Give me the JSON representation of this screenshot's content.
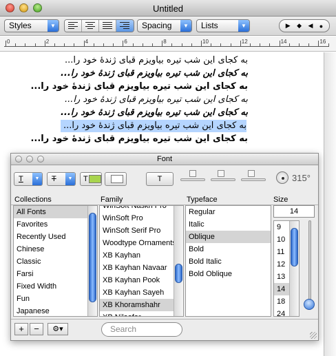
{
  "window": {
    "title": "Untitled"
  },
  "toolbar": {
    "styles_label": "Styles",
    "spacing_label": "Spacing",
    "lists_label": "Lists",
    "align_buttons": [
      "align-left",
      "align-center",
      "justify",
      "align-right"
    ],
    "active_alignment": "align-right",
    "media_icons": [
      "play-arrow",
      "diamond",
      "stop",
      "record"
    ]
  },
  "ruler": {
    "numbers": [
      "0",
      "2",
      "4",
      "6",
      "8",
      "10",
      "12",
      "14",
      "16"
    ]
  },
  "document": {
    "lines": [
      {
        "text": "به کجای این شب تیره بیاویزم قبای ژندهٔ خود را...",
        "style": "normal"
      },
      {
        "text": "به کجای این شب تیره بیاویزم قبای ژندهٔ خود را...",
        "style": "bold-italic"
      },
      {
        "text": "به کجای این شب تیره بیاویزم قبای ژندهٔ خود را...",
        "style": "bold"
      },
      {
        "text": "به کجای این شب تیره بیاویزم قبای ژندهٔ خود را...",
        "style": "italic"
      },
      {
        "text": "به کجای این شب تیره بیاویزم قبای ژندهٔ خود را...",
        "style": "bold-italic"
      },
      {
        "text": "به کجای این شب تیره بیاویزم قبای ژندهٔ خود را...",
        "style": "selected"
      },
      {
        "text": "به کجای این شب تیره بیاویزم قبای ژندهٔ خود را...",
        "style": "bold"
      }
    ]
  },
  "font_panel": {
    "title": "Font",
    "rotation": "315°",
    "text_color": "#a8d44e",
    "headers": {
      "collections": "Collections",
      "family": "Family",
      "typeface": "Typeface",
      "size": "Size"
    },
    "collections": [
      "All Fonts",
      "Favorites",
      "Recently Used",
      "Chinese",
      "Classic",
      "Farsi",
      "Fixed Width",
      "Fun",
      "Japanese"
    ],
    "collections_selected": "All Fonts",
    "families": [
      "WinSoft Naskh Pro",
      "WinSoft Pro",
      "WinSoft Serif Pro",
      "Woodtype Ornaments",
      "XB Kayhan",
      "XB Kayhan Navaar",
      "XB Kayhan Pook",
      "XB Kayhan Sayeh",
      "XB Khoramshahr",
      "XB Niloofar"
    ],
    "family_selected": "XB Khoramshahr",
    "typefaces": [
      "Regular",
      "Italic",
      "Oblique",
      "Bold",
      "Bold Italic",
      "Bold Oblique"
    ],
    "typeface_selected": "Oblique",
    "size_value": "14",
    "sizes": [
      "9",
      "10",
      "11",
      "12",
      "13",
      "14",
      "18",
      "24"
    ],
    "size_selected": "14",
    "search_placeholder": "Search",
    "add_label": "+",
    "remove_label": "−",
    "action_label": "⚙▾"
  }
}
